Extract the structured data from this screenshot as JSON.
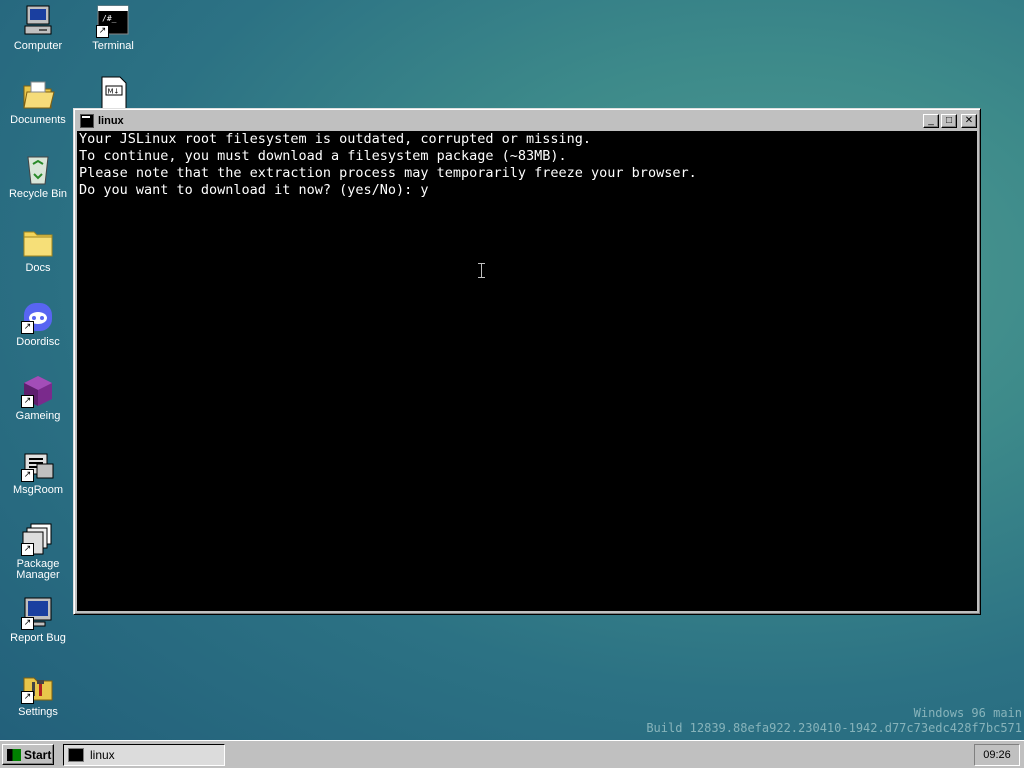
{
  "desktop": {
    "icons": [
      {
        "label": "Computer"
      },
      {
        "label": "Terminal"
      },
      {
        "label": "Documents"
      },
      {
        "label": "Recycle Bin"
      },
      {
        "label": "Docs"
      },
      {
        "label": "Doordisc"
      },
      {
        "label": "Gameing"
      },
      {
        "label": "MsgRoom"
      },
      {
        "label": "Package Manager"
      },
      {
        "label": "Report Bug"
      },
      {
        "label": "Settings"
      }
    ],
    "watermark": {
      "line1": "Windows 96 main",
      "line2": "Build 12839.88efa922.230410-1942.d77c73edc428f7bc571"
    }
  },
  "window": {
    "title": "linux",
    "controls": {
      "minimize": "_",
      "maximize": "□",
      "close": "✕"
    },
    "terminal_lines": [
      "Your JSLinux root filesystem is outdated, corrupted or missing.",
      "To continue, you must download a filesystem package (~83MB).",
      "Please note that the extraction process may temporarily freeze your browser.",
      "Do you want to download it now? (yes/No): y"
    ]
  },
  "taskbar": {
    "start_label": "Start",
    "tasks": [
      {
        "label": "linux"
      }
    ],
    "clock": "09:26"
  }
}
